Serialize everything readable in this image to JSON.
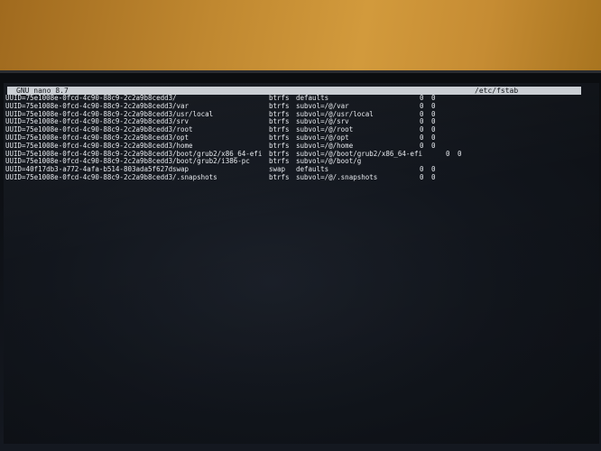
{
  "editor": {
    "app_title": "GNU nano 8.7",
    "file_name": "/etc/fstab"
  },
  "fstab": {
    "rows": [
      {
        "spec": "UUID=75e1008e-0fcd-4c90-88c9-2c2a9b8cedd3",
        "mount": "/",
        "type": "btrfs",
        "options": "defaults",
        "dump": "0",
        "pass": "0"
      },
      {
        "spec": "UUID=75e1008e-0fcd-4c90-88c9-2c2a9b8cedd3",
        "mount": "/var",
        "type": "btrfs",
        "options": "subvol=/@/var",
        "dump": "0",
        "pass": "0"
      },
      {
        "spec": "UUID=75e1008e-0fcd-4c90-88c9-2c2a9b8cedd3",
        "mount": "/usr/local",
        "type": "btrfs",
        "options": "subvol=/@/usr/local",
        "dump": "0",
        "pass": "0"
      },
      {
        "spec": "UUID=75e1008e-0fcd-4c90-88c9-2c2a9b8cedd3",
        "mount": "/srv",
        "type": "btrfs",
        "options": "subvol=/@/srv",
        "dump": "0",
        "pass": "0"
      },
      {
        "spec": "UUID=75e1008e-0fcd-4c90-88c9-2c2a9b8cedd3",
        "mount": "/root",
        "type": "btrfs",
        "options": "subvol=/@/root",
        "dump": "0",
        "pass": "0"
      },
      {
        "spec": "UUID=75e1008e-0fcd-4c90-88c9-2c2a9b8cedd3",
        "mount": "/opt",
        "type": "btrfs",
        "options": "subvol=/@/opt",
        "dump": "0",
        "pass": "0"
      },
      {
        "spec": "UUID=75e1008e-0fcd-4c90-88c9-2c2a9b8cedd3",
        "mount": "/home",
        "type": "btrfs",
        "options": "subvol=/@/home",
        "dump": "0",
        "pass": "0"
      },
      {
        "spec": "UUID=75e1008e-0fcd-4c90-88c9-2c2a9b8cedd3",
        "mount": "/boot/grub2/x86_64-efi",
        "type": "btrfs",
        "options": "subvol=/@/boot/grub2/x86_64-efi",
        "dump": "0",
        "pass": "0"
      },
      {
        "spec": "UUID=75e1008e-0fcd-4c90-88c9-2c2a9b8cedd3",
        "mount": "/boot/grub2/i386-pc",
        "type": "btrfs",
        "options": "subvol=/@/boot/g",
        "dump": "",
        "pass": ""
      },
      {
        "spec": "UUID=40f17db3-a772-4afa-b514-803ada5f627d",
        "mount": "swap",
        "type": "swap",
        "options": "defaults",
        "dump": "0",
        "pass": "0"
      },
      {
        "spec": "UUID=75e1008e-0fcd-4c90-88c9-2c2a9b8cedd3",
        "mount": "/.snapshots",
        "type": "btrfs",
        "options": "subvol=/@/.snapshots",
        "dump": "0",
        "pass": "0"
      }
    ]
  }
}
